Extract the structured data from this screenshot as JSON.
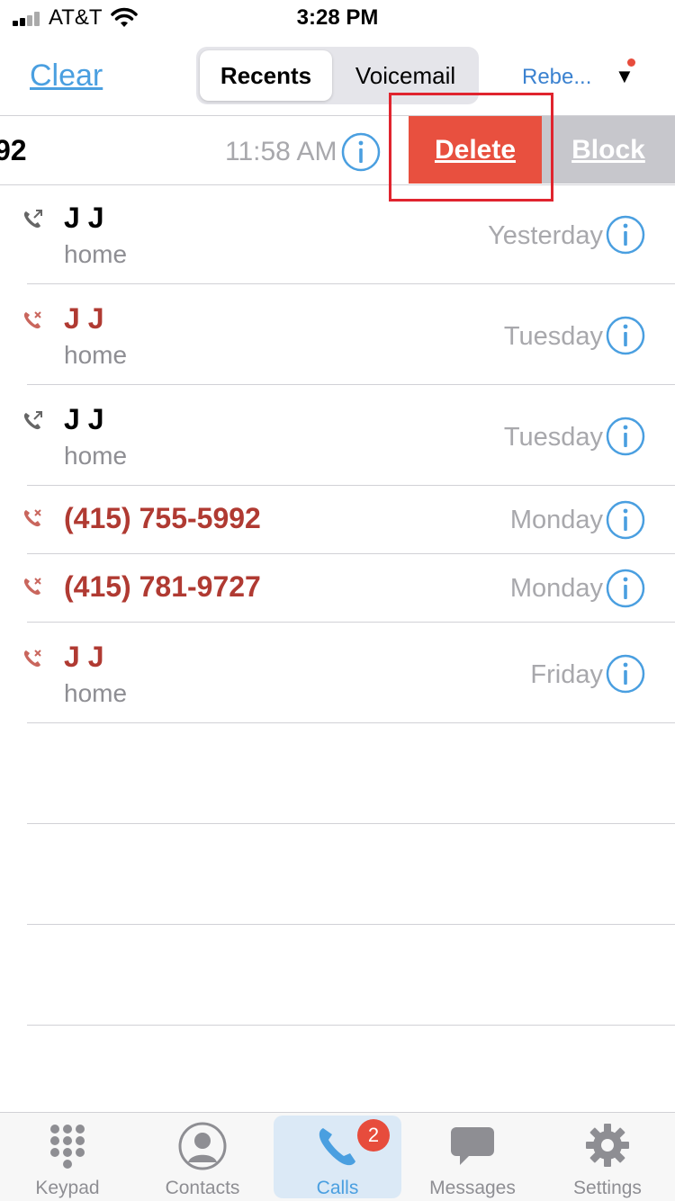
{
  "status_bar": {
    "carrier": "AT&T",
    "time": "3:28 PM"
  },
  "nav": {
    "clear_label": "Clear",
    "tabs": [
      {
        "label": "Recents",
        "active": true
      },
      {
        "label": "Voicemail",
        "active": false
      }
    ],
    "account_label": "Rebe...",
    "dropdown_symbol": "▼"
  },
  "swiped_row": {
    "number_fragment": "92",
    "time": "11:58 AM",
    "delete_label": "Delete",
    "block_label": "Block"
  },
  "calls": [
    {
      "name": "J J",
      "label": "home",
      "when": "Yesterday",
      "type": "outgoing"
    },
    {
      "name": "J J",
      "label": "home",
      "when": "Tuesday",
      "type": "missed"
    },
    {
      "name": "J J",
      "label": "home",
      "when": "Tuesday",
      "type": "outgoing"
    },
    {
      "name": "(415) 755-5992",
      "label": "",
      "when": "Monday",
      "type": "missed"
    },
    {
      "name": "(415) 781-9727",
      "label": "",
      "when": "Monday",
      "type": "missed"
    },
    {
      "name": "J J",
      "label": "home",
      "when": "Friday",
      "type": "missed"
    }
  ],
  "tab_bar": {
    "items": [
      {
        "label": "Keypad",
        "icon": "keypad-icon"
      },
      {
        "label": "Contacts",
        "icon": "contacts-icon"
      },
      {
        "label": "Calls",
        "icon": "phone-icon",
        "badge": "2",
        "active": true
      },
      {
        "label": "Messages",
        "icon": "messages-icon"
      },
      {
        "label": "Settings",
        "icon": "settings-icon"
      }
    ]
  },
  "colors": {
    "accent": "#4a9fe0",
    "missed": "#b03a32",
    "delete": "#e8503f",
    "block": "#c7c7cc",
    "badge": "#e74c3c"
  }
}
